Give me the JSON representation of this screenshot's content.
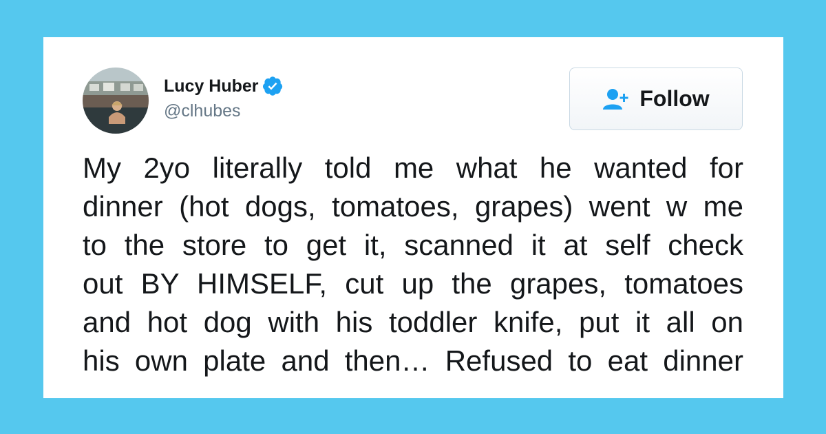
{
  "colors": {
    "background": "#55c8ee",
    "card": "#ffffff",
    "verified_blue": "#1da1f2",
    "text_primary": "#14171a",
    "text_secondary": "#657786"
  },
  "author": {
    "display_name": "Lucy Huber",
    "handle": "@clhubes",
    "verified": true,
    "avatar_icon": "profile-photo"
  },
  "follow_button": {
    "label": "Follow",
    "icon": "add-user-icon"
  },
  "tweet": {
    "lines": [
      "My 2yo literally told me what he wanted for",
      "dinner (hot dogs, tomatoes, grapes) went w me",
      "to the store to get it, scanned it at self check",
      "out BY HIMSELF, cut up the grapes, tomatoes",
      "and hot dog with his toddler knife, put it all on",
      "his own plate and then… Refused to eat dinner"
    ]
  }
}
